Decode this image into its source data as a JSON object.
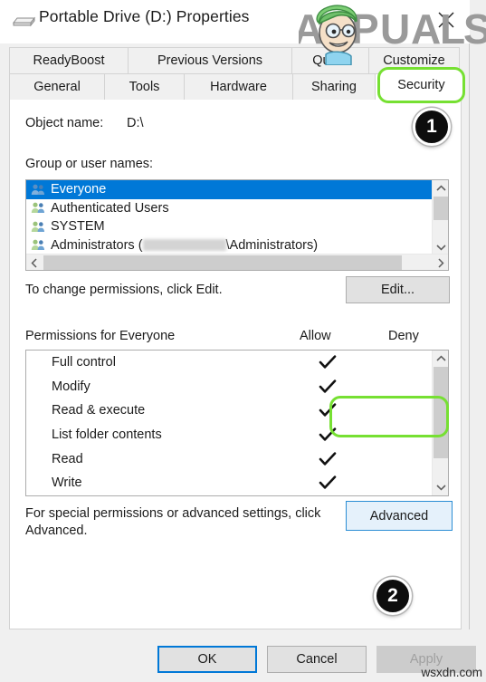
{
  "window": {
    "title": "Portable Drive (D:) Properties",
    "drive_icon": "external-drive-icon",
    "close_icon": "close-icon"
  },
  "tabs": {
    "row1": [
      {
        "label": "ReadyBoost",
        "active": false
      },
      {
        "label": "Previous Versions",
        "active": false
      },
      {
        "label": "Quota",
        "active": false
      },
      {
        "label": "Customize",
        "active": false
      }
    ],
    "row2": [
      {
        "label": "General",
        "active": false
      },
      {
        "label": "Tools",
        "active": false
      },
      {
        "label": "Hardware",
        "active": false
      },
      {
        "label": "Sharing",
        "active": false
      },
      {
        "label": "Security",
        "active": true
      }
    ]
  },
  "security": {
    "object_name_label": "Object name:",
    "object_name_value": "D:\\",
    "groups_label": "Group or user names:",
    "groups": [
      {
        "name": "Everyone",
        "selected": true,
        "redacted": false,
        "suffix": ""
      },
      {
        "name": "Authenticated Users",
        "selected": false,
        "redacted": false,
        "suffix": ""
      },
      {
        "name": "SYSTEM",
        "selected": false,
        "redacted": false,
        "suffix": ""
      },
      {
        "name": "Administrators (",
        "selected": false,
        "redacted": true,
        "suffix": "\\Administrators)"
      }
    ],
    "edit_hint": "To change permissions, click Edit.",
    "edit_button": "Edit...",
    "permissions_header": "Permissions for Everyone",
    "column_allow": "Allow",
    "column_deny": "Deny",
    "permissions": [
      {
        "name": "Full control",
        "allow": true,
        "deny": false
      },
      {
        "name": "Modify",
        "allow": true,
        "deny": false
      },
      {
        "name": "Read & execute",
        "allow": true,
        "deny": false
      },
      {
        "name": "List folder contents",
        "allow": true,
        "deny": false
      },
      {
        "name": "Read",
        "allow": true,
        "deny": false
      },
      {
        "name": "Write",
        "allow": true,
        "deny": false
      }
    ],
    "advanced_hint": "For special permissions or advanced settings, click Advanced.",
    "advanced_button": "Advanced"
  },
  "footer": {
    "ok": "OK",
    "cancel": "Cancel",
    "apply": "Apply",
    "apply_enabled": false
  },
  "annotations": {
    "badge_1": "1",
    "badge_2": "2",
    "highlight_color": "#76e032"
  },
  "watermarks": {
    "brand": "APPUALS",
    "site": "wsxdn.com"
  },
  "colors": {
    "selection_blue": "#0078d7",
    "focus_blue": "#2a8dd4",
    "button_face": "#e1e1e1",
    "disabled_text": "#a0a0a0"
  }
}
